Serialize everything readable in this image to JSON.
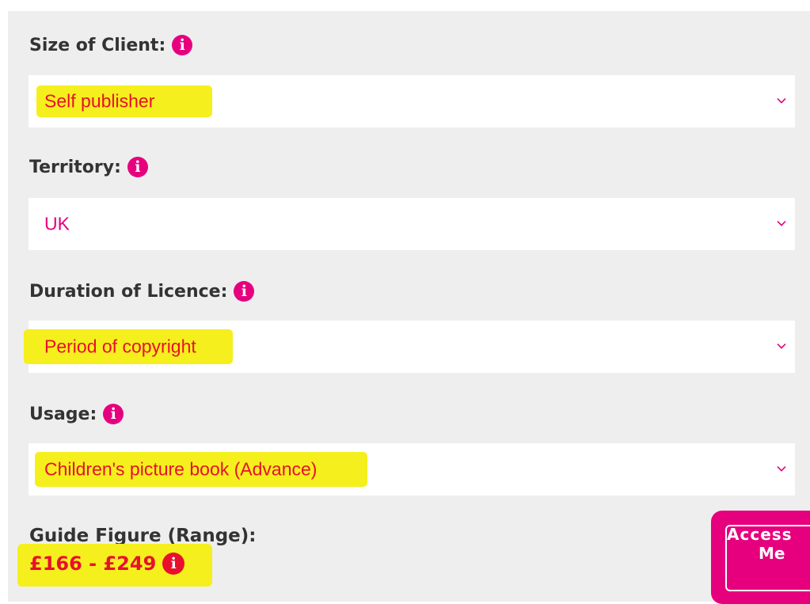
{
  "colors": {
    "accent": "#e6007e",
    "highlight": "#f5ef1d",
    "range_text": "#e8102d",
    "label_text": "#333333"
  },
  "fields": [
    {
      "label": "Size of Client:",
      "value": "Self publisher"
    },
    {
      "label": "Territory:",
      "value": "UK"
    },
    {
      "label": "Duration of Licence:",
      "value": "Period of copyright"
    },
    {
      "label": "Usage:",
      "value": "Children's picture book (Advance)"
    }
  ],
  "info_icon_glyph": "i",
  "chevron_icon": "chevron-down-icon",
  "guide": {
    "label": "Guide Figure (Range):",
    "range": "£166 - £249"
  },
  "access_button": {
    "line1": "Access",
    "line2": "Me"
  }
}
